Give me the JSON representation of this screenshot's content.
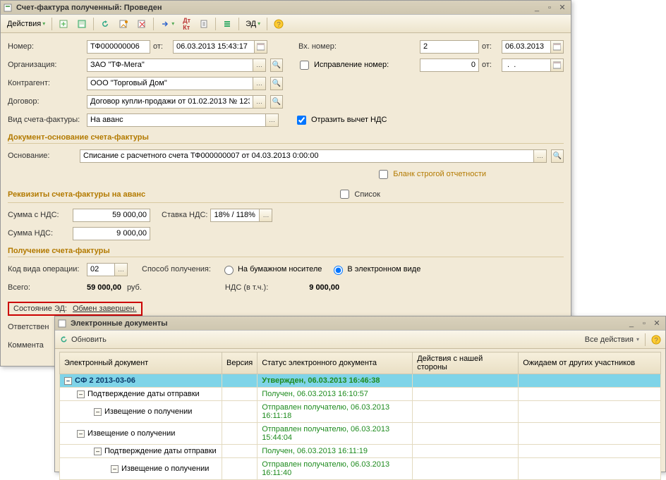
{
  "win1": {
    "title": "Счет-фактура полученный: Проведен",
    "toolbar": {
      "actions_label": "Действия",
      "edi_label": "ЭД"
    },
    "labels": {
      "number": "Номер:",
      "from": "от:",
      "org": "Организация:",
      "counterparty": "Контрагент:",
      "contract": "Договор:",
      "kind": "Вид счета-фактуры:",
      "ext_number": "Вх. номер:",
      "correction": "Исправление номер:",
      "reflect_vat": "Отразить вычет НДС",
      "section_basis": "Документ-основание счета-фактуры",
      "basis": "Основание:",
      "strict_blank": "Бланк строгой отчетности",
      "section_details": "Реквизиты счета-фактуры на аванс",
      "list": "Список",
      "sum_with_vat": "Сумма с НДС:",
      "vat_rate": "Ставка НДС:",
      "sum_vat": "Сумма НДС:",
      "section_receive": "Получение счета-фактуры",
      "op_code": "Код вида операции:",
      "recv_method": "Способ получения:",
      "paper": "На бумажном носителе",
      "electronic": "В электронном виде",
      "total": "Всего:",
      "rub": "руб.",
      "vat_in": "НДС (в т.ч.):",
      "edi_state": "Состояние ЭД:",
      "edi_done": "Обмен завершен.",
      "responsibles": "Ответствен",
      "comment": "Коммента"
    },
    "values": {
      "number": "ТФ000000006",
      "date": "06.03.2013 15:43:17",
      "org": "ЗАО \"ТФ-Мега\"",
      "counterparty": "ООО \"Торговый Дом\"",
      "contract": "Договор купли-продажи от 01.02.2013 № 123",
      "kind": "На аванс",
      "ext_number": "2",
      "ext_date": "06.03.2013",
      "correction_no": "0",
      "correction_date": " .  .    ",
      "basis": "Списание с расчетного счета ТФ000000007 от 04.03.2013 0:00:00",
      "sum_with_vat": "59 000,00",
      "vat_rate": "18% / 118%",
      "sum_vat": "9 000,00",
      "op_code": "02",
      "total": "59 000,00",
      "vat_total": "9 000,00"
    }
  },
  "win2": {
    "title": "Электронные документы",
    "toolbar": {
      "refresh": "Обновить",
      "all_actions": "Все действия"
    },
    "cols": {
      "doc": "Электронный документ",
      "ver": "Версия",
      "status": "Статус электронного документа",
      "our": "Действия с нашей стороны",
      "other": "Ожидаем от других участников"
    },
    "rows": [
      {
        "level": 0,
        "name": "СФ 2 2013-03-06",
        "status": "Утвержден, 06.03.2013 16:46:38",
        "selected": true,
        "boldStatus": true
      },
      {
        "level": 1,
        "name": "Подтверждение даты отправки",
        "status": "Получен, 06.03.2013 16:10:57"
      },
      {
        "level": 2,
        "name": "Извещение о получении",
        "status": "Отправлен получателю, 06.03.2013 16:11:18"
      },
      {
        "level": 1,
        "name": "Извещение о получении",
        "status": "Отправлен получателю, 06.03.2013 15:44:04"
      },
      {
        "level": 2,
        "name": "Подтверждение даты отправки",
        "status": "Получен, 06.03.2013 16:11:19"
      },
      {
        "level": 3,
        "name": "Извещение о получении",
        "status": "Отправлен получателю, 06.03.2013 16:11:40"
      }
    ]
  }
}
